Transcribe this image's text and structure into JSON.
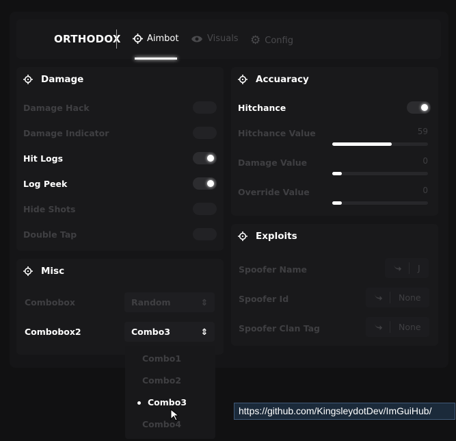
{
  "header": {
    "brand": "ORTHODOX",
    "tabs": [
      {
        "label": "Aimbot",
        "icon": "crosshair-icon",
        "active": true
      },
      {
        "label": "Visuals",
        "icon": "eye-icon",
        "active": false
      },
      {
        "label": "Config",
        "icon": "gear-icon",
        "active": false
      }
    ]
  },
  "damage": {
    "title": "Damage",
    "items": [
      {
        "label": "Damage Hack",
        "on": false
      },
      {
        "label": "Damage Indicator",
        "on": false
      },
      {
        "label": "Hit Logs",
        "on": true
      },
      {
        "label": "Log Peek",
        "on": true
      },
      {
        "label": "Hide Shots",
        "on": false
      },
      {
        "label": "Double Tap",
        "on": false
      }
    ]
  },
  "misc": {
    "title": "Misc",
    "combo1": {
      "label": "Combobox",
      "value": "Random"
    },
    "combo2": {
      "label": "Combobox2",
      "value": "Combo3",
      "options": [
        "Combo1",
        "Combo2",
        "Combo3",
        "Combo4"
      ],
      "selected": "Combo3"
    }
  },
  "accuracy": {
    "title": "Accuaracy",
    "hitchance": {
      "label": "Hitchance",
      "on": true
    },
    "sliders": [
      {
        "label": "Hitchance Value",
        "value": "59",
        "fraction": 0.62
      },
      {
        "label": "Damage Value",
        "value": "0",
        "fraction": 0.1
      },
      {
        "label": "Override Value",
        "value": "0",
        "fraction": 0.1
      }
    ]
  },
  "exploits": {
    "title": "Exploits",
    "items": [
      {
        "label": "Spoofer Name",
        "key": "J"
      },
      {
        "label": "Spoofer Id",
        "key": "None"
      },
      {
        "label": "Spoofer Clan Tag",
        "key": "None"
      }
    ]
  },
  "tooltip": "https://github.com/KingsleydotDev/ImGuiHub/"
}
